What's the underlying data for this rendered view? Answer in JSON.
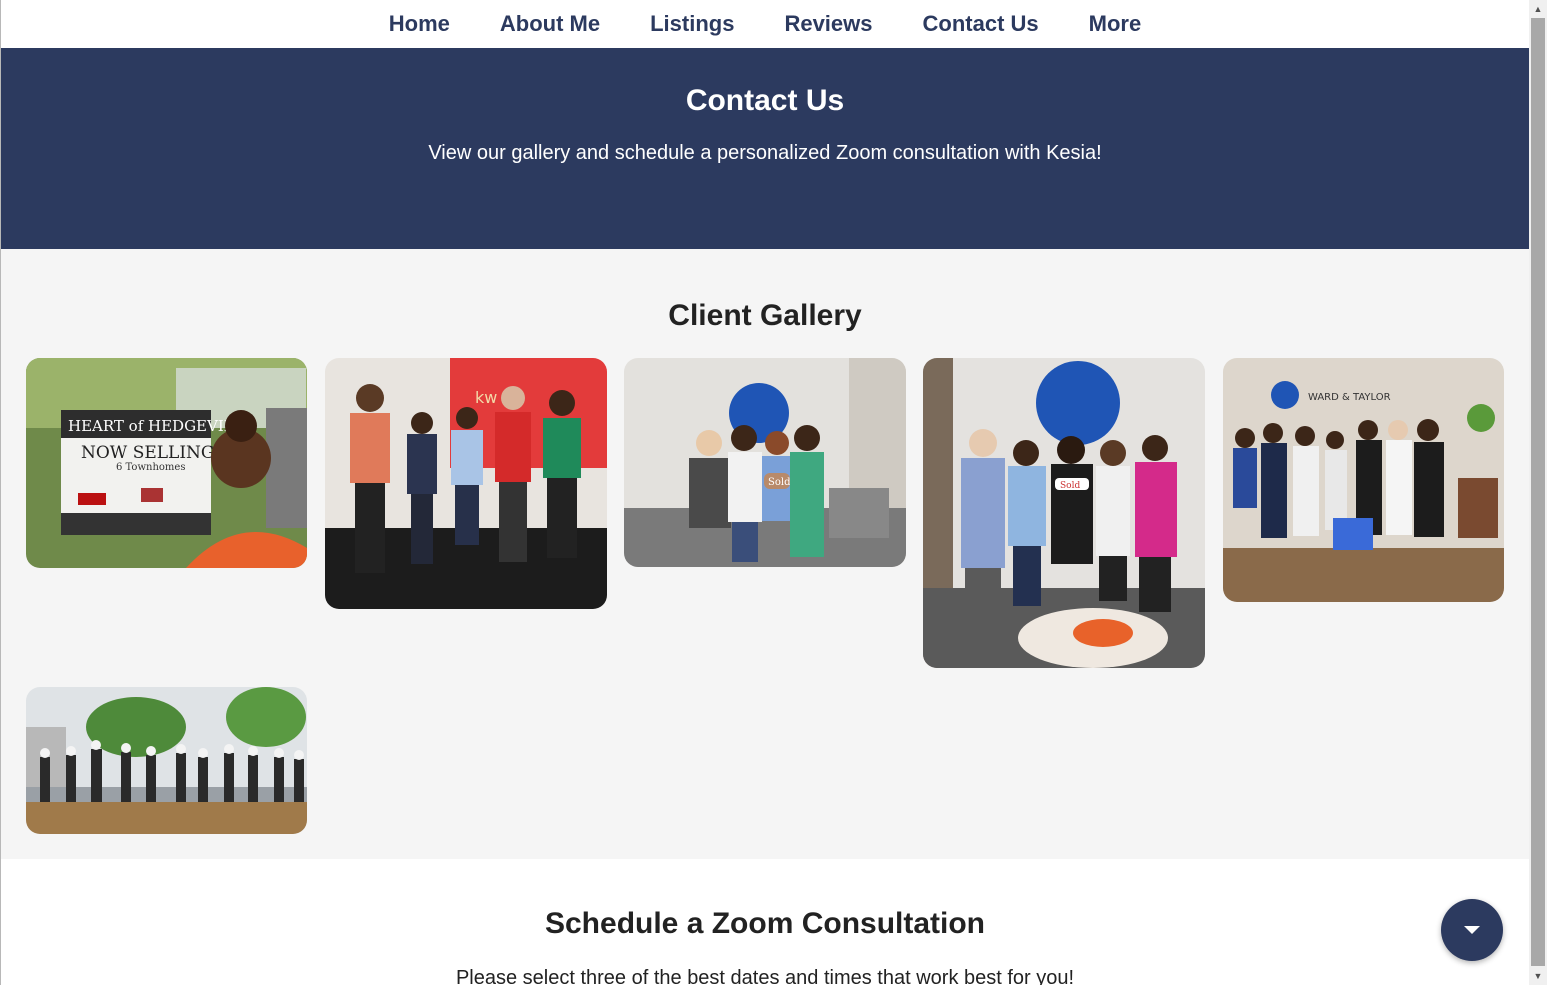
{
  "nav": {
    "items": [
      {
        "label": "Home"
      },
      {
        "label": "About Me"
      },
      {
        "label": "Listings"
      },
      {
        "label": "Reviews"
      },
      {
        "label": "Contact Us"
      },
      {
        "label": "More"
      }
    ]
  },
  "hero": {
    "title": "Contact Us",
    "subtitle": "View our gallery and schedule a personalized Zoom consultation with Kesia!"
  },
  "gallery": {
    "title": "Client Gallery",
    "photos": [
      {
        "sign_line1": "HEART of HEDGEVILLE",
        "sign_line2": "NOW SELLING",
        "sign_line3": "6 Townhomes"
      },
      {
        "logo": "kw"
      },
      {
        "badge": "Sold"
      },
      {
        "badge": "Sold"
      },
      {
        "logo": "WARD & TAYLOR"
      },
      {}
    ]
  },
  "zoom": {
    "title": "Schedule a Zoom Consultation",
    "text": "Please select three of the best dates and times that work best for you!"
  },
  "colors": {
    "navy": "#2c3a5f",
    "gallery_bg": "#f5f5f5"
  },
  "icons": {
    "fab": "chevron-down-icon"
  }
}
